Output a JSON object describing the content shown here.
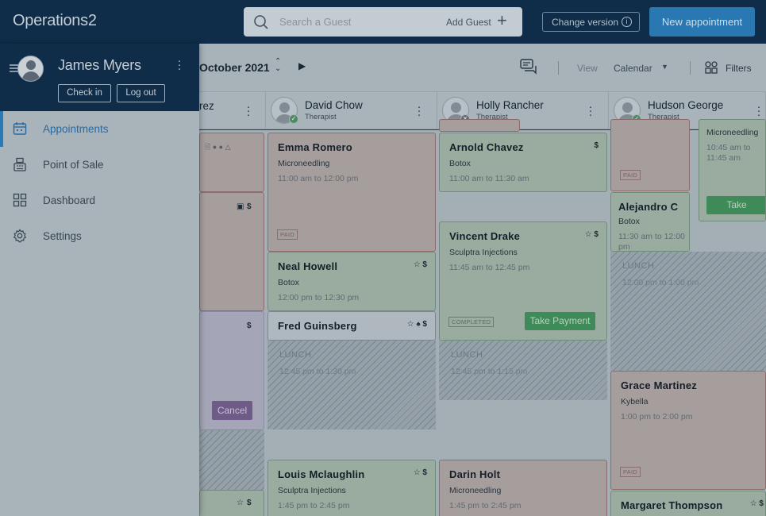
{
  "header": {
    "brand": "Operations2",
    "search_placeholder": "Search a Guest",
    "add_guest": "Add Guest",
    "change_version": "Change version",
    "new_appointment": "New appointment"
  },
  "sidebar": {
    "user_name": "James Myers",
    "check_in": "Check in",
    "log_out": "Log out",
    "items": [
      {
        "label": "Appointments",
        "icon": "calendar-icon",
        "active": true
      },
      {
        "label": "Point of Sale",
        "icon": "cash-register-icon",
        "active": false
      },
      {
        "label": "Dashboard",
        "icon": "dashboard-grid-icon",
        "active": false
      },
      {
        "label": "Settings",
        "icon": "gear-icon",
        "active": false
      }
    ]
  },
  "toolbar": {
    "month": "October 2021",
    "view_label": "View",
    "view_value": "Calendar",
    "filters": "Filters"
  },
  "staff": [
    {
      "name": "rez"
    },
    {
      "name": "David Chow",
      "role": "Therapist",
      "status": "available"
    },
    {
      "name": "Holly Rancher",
      "role": "Therapist",
      "status": "unavailable"
    },
    {
      "name": "Hudson George",
      "role": "Therapist",
      "status": "available"
    }
  ],
  "col0": {
    "dollar1": "$",
    "dollar2": "$",
    "cancel": "Cancel",
    "dollar3": "$"
  },
  "col1": {
    "appts": [
      {
        "name": "Emma Romero",
        "service": "Microneedling",
        "time": "11:00 am to 12:00 pm",
        "tag": "PAID"
      },
      {
        "name": "Neal Howell",
        "service": "Botox",
        "time": "12:00 pm to 12:30 pm",
        "icons": "☆ $"
      },
      {
        "name": "Fred Guinsberg",
        "icons": "☆ ♠ $"
      },
      {
        "name": "Louis Mclaughlin",
        "service": "Sculptra Injections",
        "time": "1:45 pm to 2:45 pm",
        "icons": "☆ $"
      }
    ],
    "lunch_label": "LUNCH",
    "lunch_time": "12:45 pm to 1:30 pm"
  },
  "col2": {
    "appts": [
      {
        "name": "Arnold Chavez",
        "service": "Botox",
        "time": "11:00 am to 11:30 am",
        "icons": "$"
      },
      {
        "name": "Vincent Drake",
        "service": "Sculptra Injections",
        "time": "11:45 am to 12:45 pm",
        "icons": "☆ $",
        "tag": "COMPLETED",
        "button": "Take Payment"
      },
      {
        "name": "Darin Holt",
        "service": "Microneedling",
        "time": "1:45 pm to 2:45 pm"
      }
    ],
    "lunch_label": "LUNCH",
    "lunch_time": "12:45 pm to 1:15 pm"
  },
  "col3": {
    "appts": [
      {
        "tag": "PAID"
      },
      {
        "name": "Alejandro C",
        "service": "Botox",
        "time": "11:30 am to 12:00 pm"
      },
      {
        "name": "Grace Martinez",
        "service": "Kybella",
        "time": "1:00 pm to 2:00 pm",
        "tag": "PAID"
      },
      {
        "name": "Margaret Thompson",
        "icons": "☆ $"
      }
    ],
    "lunch_label": "LUNCH",
    "lunch_time": "12:00 pm to 1:00 pm"
  },
  "col4": {
    "service": "Microneedling",
    "time": "10:45 am to 11:45 am",
    "button": "Take"
  },
  "colors": {
    "header_bg": "#0f2c48",
    "accent": "#2a78b2",
    "paid_red": "#a69e9c",
    "completed_green": "#9aab9f",
    "take_payment": "#3e8a58"
  }
}
